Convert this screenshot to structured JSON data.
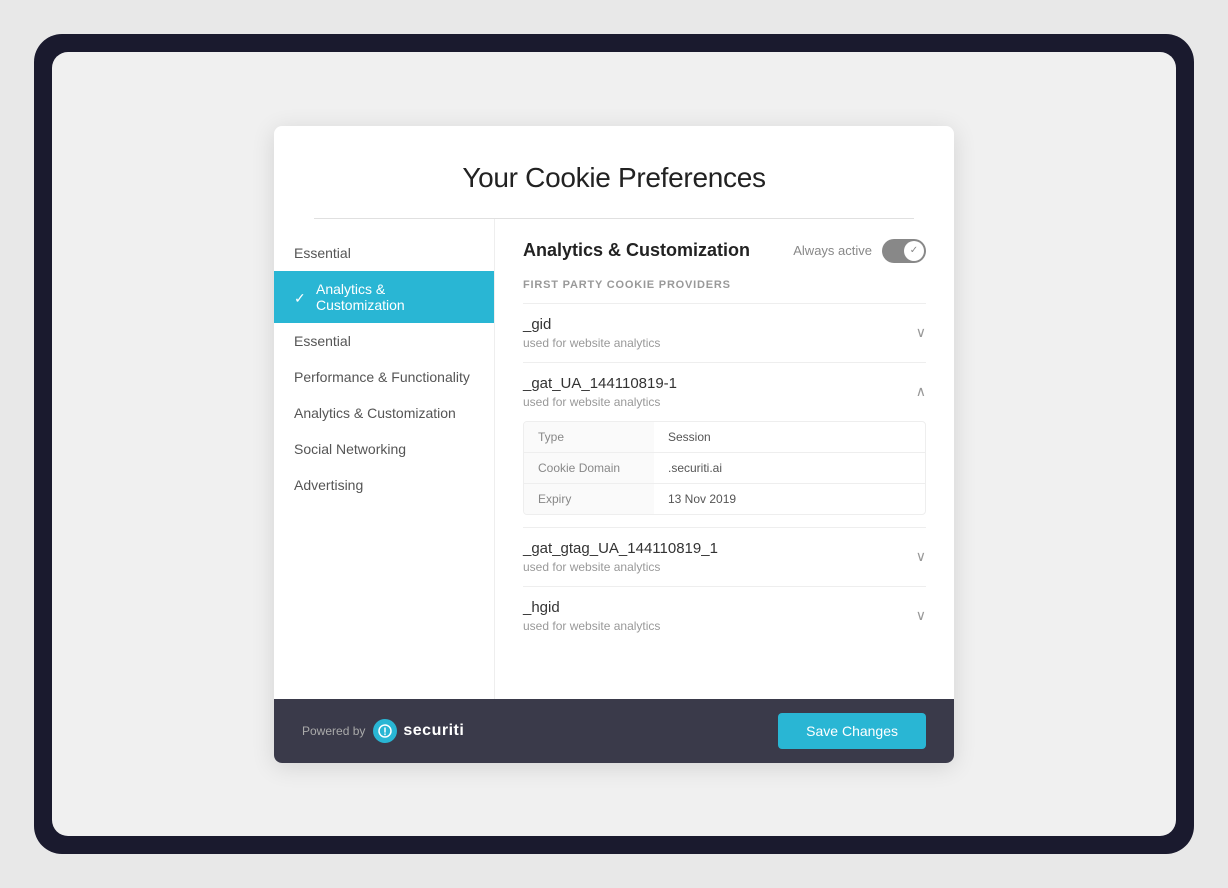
{
  "modal": {
    "title": "Your Cookie Preferences",
    "divider": true
  },
  "sidebar": {
    "items": [
      {
        "id": "essential-top",
        "label": "Essential",
        "active": false
      },
      {
        "id": "analytics-customization",
        "label": "Analytics & Customization",
        "active": true
      },
      {
        "id": "essential",
        "label": "Essential",
        "active": false
      },
      {
        "id": "performance-functionality",
        "label": "Performance & Functionality",
        "active": false
      },
      {
        "id": "analytics-customization2",
        "label": "Analytics & Customization",
        "active": false
      },
      {
        "id": "social-networking",
        "label": "Social Networking",
        "active": false
      },
      {
        "id": "advertising",
        "label": "Advertising",
        "active": false
      }
    ]
  },
  "content": {
    "title": "Analytics & Customization",
    "always_active_label": "Always active",
    "section_label": "FIRST PARTY COOKIE PROVIDERS",
    "cookies": [
      {
        "id": "gid",
        "name": "_gid",
        "description": "used for website analytics",
        "expanded": false,
        "details": []
      },
      {
        "id": "gat_ua",
        "name": "_gat_UA_144110819-1",
        "description": "used for website analytics",
        "expanded": true,
        "details": [
          {
            "label": "Type",
            "value": "Session"
          },
          {
            "label": "Cookie Domain",
            "value": ".securiti.ai"
          },
          {
            "label": "Expiry",
            "value": "13 Nov 2019"
          }
        ]
      },
      {
        "id": "gat_gtag",
        "name": "_gat_gtag_UA_144110819_1",
        "description": "used for website analytics",
        "expanded": false,
        "details": []
      },
      {
        "id": "hgid",
        "name": "_hgid",
        "description": "used for website analytics",
        "expanded": false,
        "details": []
      }
    ]
  },
  "footer": {
    "powered_by_label": "Powered by",
    "brand_name": "securiti",
    "save_button_label": "Save Changes"
  },
  "icons": {
    "check": "✓",
    "chevron_down": "∨",
    "chevron_up": "∧",
    "shield": "🔒"
  }
}
